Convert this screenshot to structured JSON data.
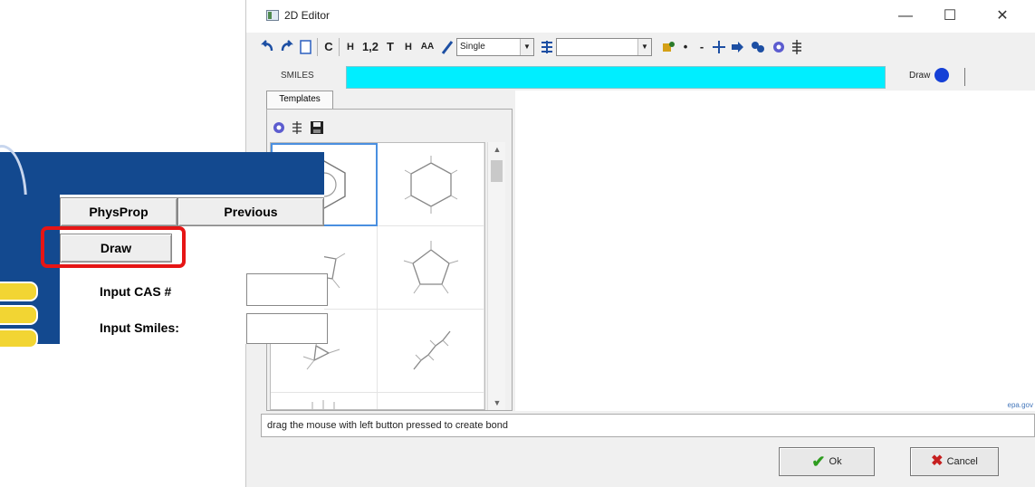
{
  "editor": {
    "title": "2D Editor",
    "window_buttons": {
      "minimize": "—",
      "maximize": "☐",
      "close": "✕"
    },
    "toolbar": {
      "carbon": "C",
      "hydrogen1": "H",
      "numbering": "1,2",
      "text": "T",
      "hydrogen2": "H",
      "atom_labels": "AA",
      "bond_type": "Single",
      "atom_combo_value": ""
    },
    "smiles_label": "SMILES",
    "smiles_value": "",
    "draw_label": "Draw",
    "tab_label": "Templates",
    "status_text": "drag the mouse with left button pressed to create bond",
    "site_url": "epa.gov",
    "ok_label": "Ok",
    "cancel_label": "Cancel"
  },
  "background_app": {
    "physprop_label": "PhysProp",
    "previous_label": "Previous",
    "draw_label": "Draw",
    "input_cas_label": "Input CAS #",
    "input_smiles_label": "Input Smiles:",
    "input_cas_value": "",
    "input_smiles_value": ""
  },
  "colors": {
    "smiles_field": "#00eeff",
    "banner": "#13498f",
    "highlight": "#e61515",
    "draw_dot": "#1540d6"
  }
}
